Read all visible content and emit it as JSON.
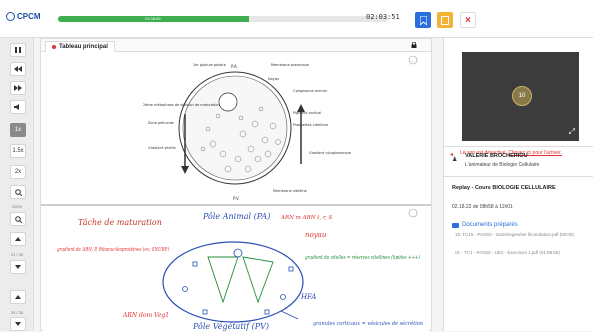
{
  "header": {
    "logo_text": "CPCM",
    "progress_label": "01:08:59",
    "progress_fraction": 0.58,
    "clock": "02:03:51",
    "close_label": "×"
  },
  "sidebar": {
    "speed_1x": "1x",
    "speed_15x": "1.5x",
    "speed_2x": "2x",
    "zoom_label": "100%",
    "page_label": "21 / 35",
    "page_label_bottom": "25 / 35"
  },
  "main": {
    "tab_label": "Tableau principal"
  },
  "slide": {
    "label_pa": "P.A.",
    "label_pv": "P.V.",
    "label_vesicule": "1er globule polaire",
    "label_membrane_plasma": "Membrane plasmique",
    "label_zone": "Zone pellucide",
    "label_noyau": "Noyau",
    "label_cytoplasme": "Cytoplasme animal",
    "label_pigment": "Pigment cortical",
    "label_plaquettes": "Plaquettes vitellines",
    "label_gradient_left": "Gradient vitellin",
    "label_gradient_right": "Gradient cytoplasmique",
    "label_membrane_vit": "Membrane vitelline",
    "label_2nd": "2ème métaphase de division de maturation"
  },
  "notes": {
    "tache": "Tâche de maturation",
    "pole_animal": "Pôle Animal (PA)",
    "arn": "ARN m ARN t, r, S",
    "noyau": "noyau",
    "gradient_left": "gradient de ARN, P, Ribonucléoprotéines (ex: SNURP)",
    "gradient_right": "gradient de vitelles = réserves vitellines (lipides +++)",
    "hfa": "HFA",
    "arn_bas": "ARN dom Veg1",
    "pole_veg": "Pôle Végétatif (PV)",
    "granules": "granules corticaux = vésicules de sécrétion"
  },
  "right": {
    "avatar_label": "10",
    "sound_text": "Le son est désactivé.",
    "sound_link": "Cliquez ici pour l'activer.",
    "presenter_name": "VALERIE BROCHERIOU",
    "presenter_role": "L'animateur de Biologie Cellulaire",
    "replay_label": "Replay",
    "replay_course": "- Cours BIOLOGIE CELLULAIRE",
    "replay_date": "02.18.22 de 08h58 à 11h01",
    "docs_title": "Documents préparés",
    "docs": [
      "15. TC15 - PASS0 - Gamétogenèse fécondation.pdf (00:00)",
      "01 - TC1 - PASS0 - UE2 - Exercices 1.pdf (01:58:56)"
    ]
  },
  "colors": {
    "accent_blue": "#2a6fdb",
    "accent_orange": "#f2b233",
    "progress_green": "#3fae4f",
    "warning_red": "#e03232"
  }
}
